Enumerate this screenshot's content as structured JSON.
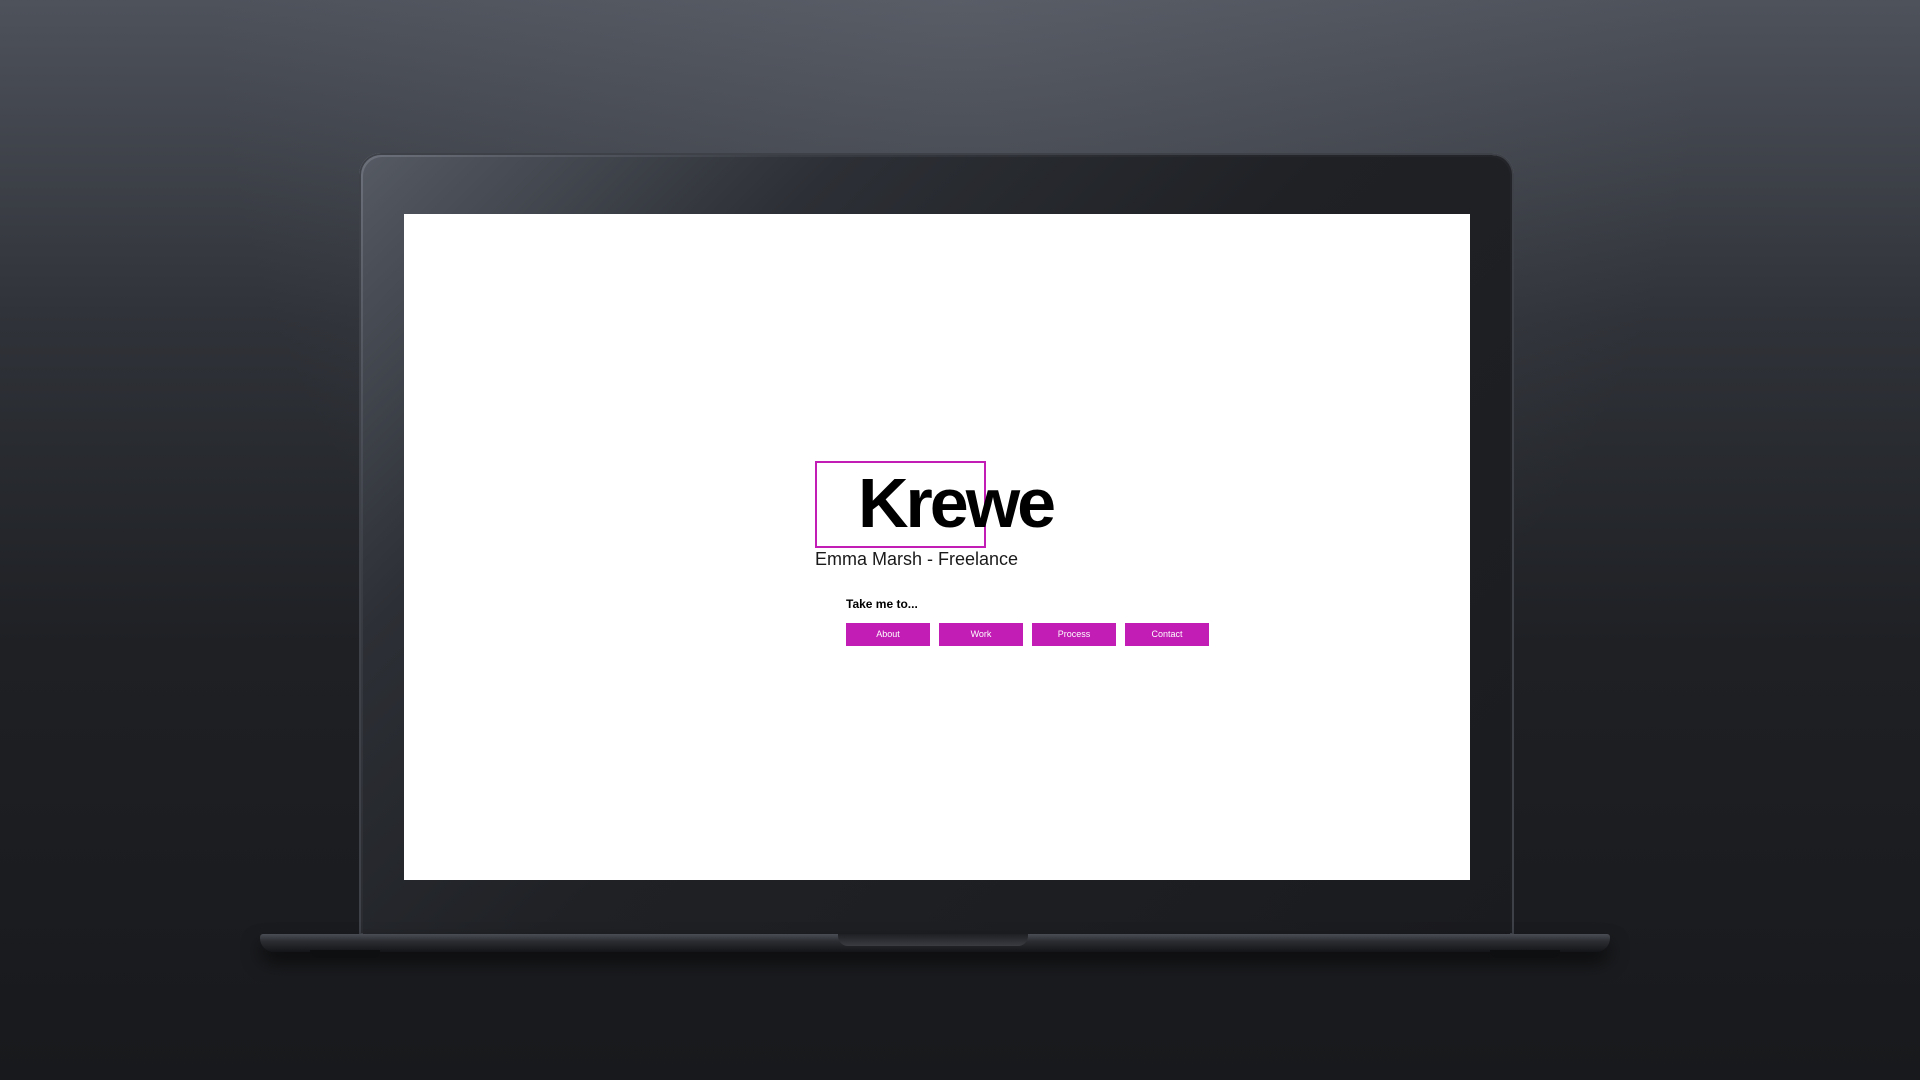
{
  "site": {
    "logo_text": "Krewe",
    "subtitle": "Emma Marsh - Freelance",
    "nav_heading": "Take me to...",
    "nav_buttons": [
      {
        "label": "About"
      },
      {
        "label": "Work"
      },
      {
        "label": "Process"
      },
      {
        "label": "Contact"
      }
    ]
  },
  "colors": {
    "accent": "#c21db4",
    "background": "#ffffff",
    "text": "#000000",
    "device_backdrop": "#1e2024"
  }
}
